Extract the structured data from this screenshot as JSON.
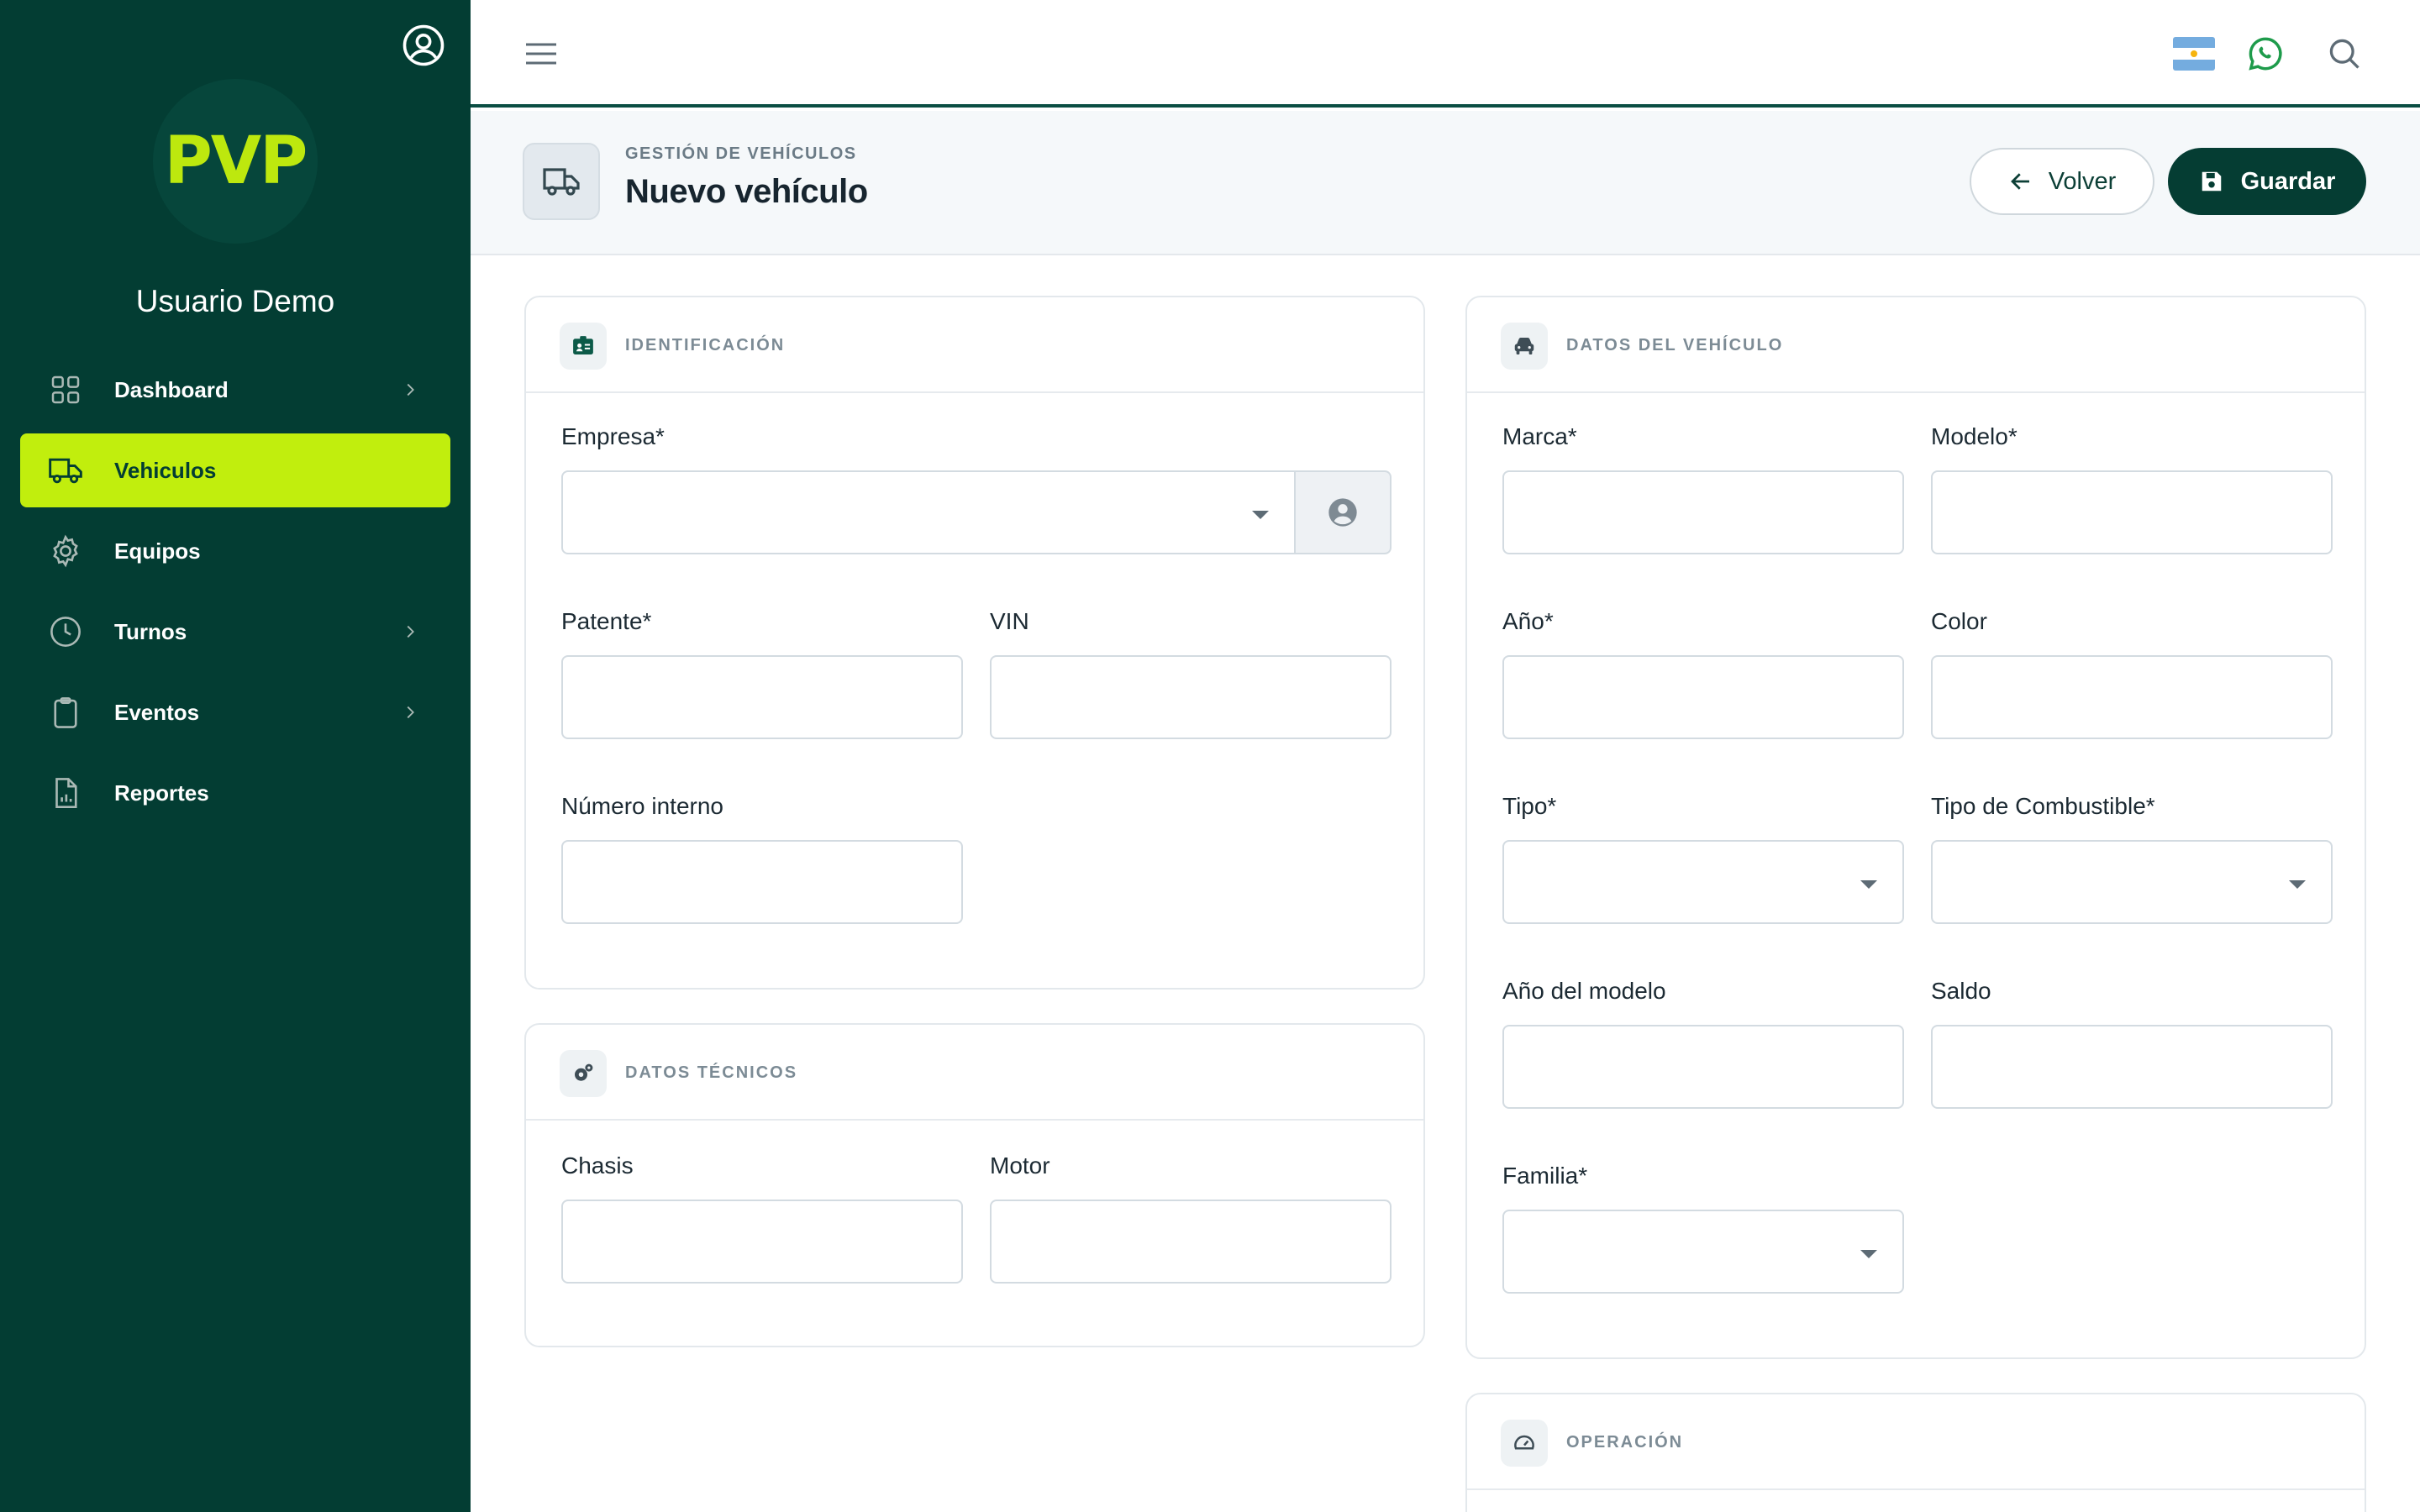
{
  "sidebar": {
    "logo_text": "PVP",
    "username": "Usuario Demo",
    "items": [
      {
        "label": "Dashboard",
        "icon": "grid-icon",
        "chevron": true
      },
      {
        "label": "Vehiculos",
        "icon": "truck-icon",
        "chevron": false,
        "active": true
      },
      {
        "label": "Equipos",
        "icon": "gear-icon",
        "chevron": false
      },
      {
        "label": "Turnos",
        "icon": "clock-icon",
        "chevron": true
      },
      {
        "label": "Eventos",
        "icon": "clipboard-icon",
        "chevron": true
      },
      {
        "label": "Reportes",
        "icon": "report-file-icon",
        "chevron": false
      }
    ]
  },
  "colors": {
    "sidebar_bg": "#033d33",
    "accent": "#c1ee0d",
    "primary_button": "#053d33"
  },
  "header": {
    "breadcrumb": "GESTIÓN DE VEHÍCULOS",
    "title": "Nuevo vehículo",
    "back_label": "Volver",
    "save_label": "Guardar"
  },
  "cards": {
    "identificacion": {
      "title": "IDENTIFICACIÓN",
      "empresa_label": "Empresa*",
      "patente_label": "Patente*",
      "vin_label": "VIN",
      "numero_interno_label": "Número interno"
    },
    "datos_tecnicos": {
      "title": "DATOS TÉCNICOS",
      "chasis_label": "Chasis",
      "motor_label": "Motor"
    },
    "datos_vehiculo": {
      "title": "DATOS DEL VEHÍCULO",
      "marca_label": "Marca*",
      "modelo_label": "Modelo*",
      "anio_label": "Año*",
      "color_label": "Color",
      "tipo_label": "Tipo*",
      "combustible_label": "Tipo de Combustible*",
      "anio_modelo_label": "Año del modelo",
      "saldo_label": "Saldo",
      "familia_label": "Familia*"
    },
    "operacion": {
      "title": "OPERACIÓN"
    }
  }
}
